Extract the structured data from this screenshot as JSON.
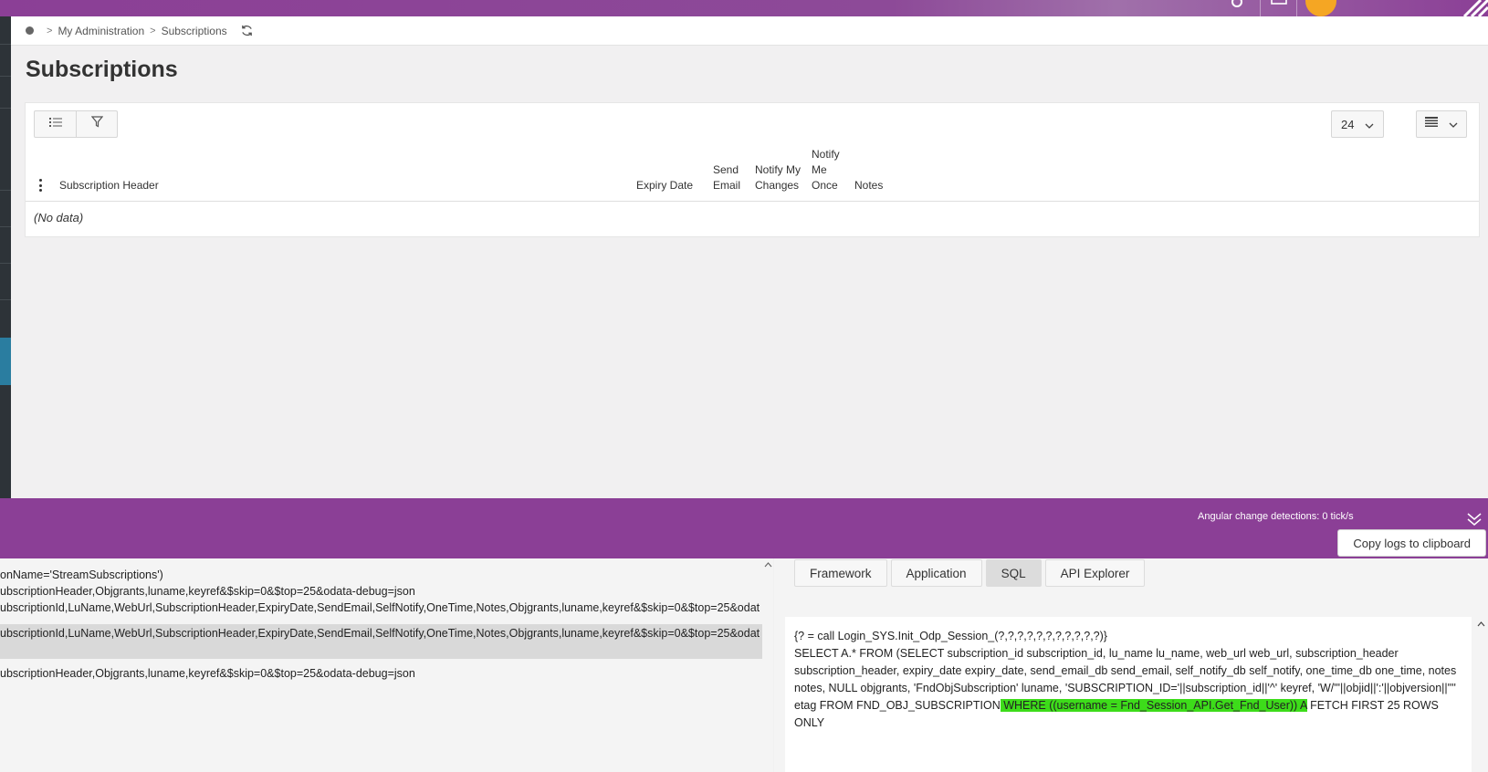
{
  "topbar": {
    "accent": "#8b3f96",
    "avatar_color": "#f5a623"
  },
  "breadcrumb": {
    "home_icon": "home-dot-icon",
    "items": [
      "My Administration",
      "Subscriptions"
    ],
    "separator": ">"
  },
  "page": {
    "title": "Subscriptions"
  },
  "toolbar": {
    "list_icon": "list-icon",
    "filter_icon": "filter-icon",
    "page_size": "24",
    "view_icon": "view-mode-icon"
  },
  "table": {
    "columns": [
      "Subscription Header",
      "Expiry Date",
      "Send Email",
      "Notify My Changes",
      "Notify Me Once",
      "Notes"
    ],
    "empty_text": "(No data)"
  },
  "debug": {
    "change_detection": "Angular change detections: 0 tick/s",
    "copy_label": "Copy logs to clipboard",
    "tabs": [
      "Framework",
      "Application",
      "SQL",
      "API Explorer"
    ],
    "active_tab": "SQL"
  },
  "logs": [
    "onName='StreamSubscriptions')",
    "ubscriptionHeader,Objgrants,luname,keyref&$skip=0&$top=25&odata-debug=json",
    "ubscriptionId,LuName,WebUrl,SubscriptionHeader,ExpiryDate,SendEmail,SelfNotify,OneTime,Notes,Objgrants,luname,keyref&$skip=0&$top=25&odat",
    "ubscriptionId,LuName,WebUrl,SubscriptionHeader,ExpiryDate,SendEmail,SelfNotify,OneTime,Notes,Objgrants,luname,keyref&$skip=0&$top=25&odat",
    "ubscriptionHeader,Objgrants,luname,keyref&$skip=0&$top=25&odata-debug=json"
  ],
  "sql": {
    "line1": "{? = call Login_SYS.Init_Odp_Session_(?,?,?,?,?,?,?,?,?,?,?)}",
    "before": "SELECT A.* FROM (SELECT subscription_id subscription_id, lu_name lu_name, web_url web_url, subscription_header subscription_header, expiry_date expiry_date, send_email_db send_email, self_notify_db self_notify, one_time_db one_time, notes notes, NULL objgrants, 'FndObjSubscription' luname, 'SUBSCRIPTION_ID='||subscription_id||'^' keyref, 'W/\"'||objid||':'||objversion||'\"' etag FROM FND_OBJ_SUBSCRIPTION",
    "highlight": " WHERE ((username = Fnd_Session_API.Get_Fnd_User)) A",
    "after": " FETCH FIRST 25 ROWS ONLY"
  }
}
